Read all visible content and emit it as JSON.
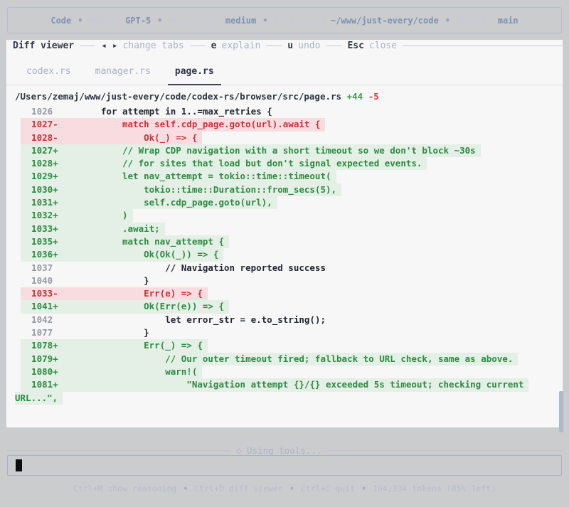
{
  "top_bar": {
    "app_name": "Code",
    "separator": "•",
    "items": [
      {
        "label": "Model: ",
        "value": "GPT-5"
      },
      {
        "label": "Reasoning: ",
        "value": "medium"
      },
      {
        "label": "Directory: ",
        "value": "~/www/just-every/code"
      },
      {
        "label": "Branch: ",
        "value": "main"
      }
    ]
  },
  "diff_viewer": {
    "title": "Diff viewer",
    "hints": [
      {
        "key": "◂ ▸",
        "label": "change tabs"
      },
      {
        "key": "e",
        "label": "explain"
      },
      {
        "key": "u",
        "label": "undo"
      },
      {
        "key": "Esc",
        "label": "close"
      }
    ],
    "tabs": [
      {
        "id": "codex-rs",
        "label": "codex.rs",
        "active": false
      },
      {
        "id": "manager-rs",
        "label": "manager.rs",
        "active": false
      },
      {
        "id": "page-rs",
        "label": "page.rs",
        "active": true
      }
    ],
    "file_header": {
      "path": "/Users/zemaj/www/just-every/code/codex-rs/browser/src/page.rs",
      "additions": "+44",
      "deletions": "-5"
    },
    "lines": [
      {
        "num": "1026",
        "sign": " ",
        "type": "ctx",
        "code": "        for attempt in 1..=max_retries {"
      },
      {
        "num": "1027",
        "sign": "-",
        "type": "del",
        "code": "            match self.cdp_page.goto(url).await {"
      },
      {
        "num": "1028",
        "sign": "-",
        "type": "del",
        "code": "                Ok(_) => {"
      },
      {
        "num": "1027",
        "sign": "+",
        "type": "add",
        "code": "            // Wrap CDP navigation with a short timeout so we don't block ~30s"
      },
      {
        "num": "1028",
        "sign": "+",
        "type": "add",
        "code": "            // for sites that load but don't signal expected events."
      },
      {
        "num": "1029",
        "sign": "+",
        "type": "add",
        "code": "            let nav_attempt = tokio::time::timeout("
      },
      {
        "num": "1030",
        "sign": "+",
        "type": "add",
        "code": "                tokio::time::Duration::from_secs(5),"
      },
      {
        "num": "1031",
        "sign": "+",
        "type": "add",
        "code": "                self.cdp_page.goto(url),"
      },
      {
        "num": "1032",
        "sign": "+",
        "type": "add",
        "code": "            )"
      },
      {
        "num": "1033",
        "sign": "+",
        "type": "add",
        "code": "            .await;"
      },
      {
        "num": "1035",
        "sign": "+",
        "type": "add",
        "code": "            match nav_attempt {"
      },
      {
        "num": "1036",
        "sign": "+",
        "type": "add",
        "code": "                Ok(Ok(_)) => {"
      },
      {
        "num": "1037",
        "sign": " ",
        "type": "ctx",
        "code": "                    // Navigation reported success"
      },
      {
        "num": "1040",
        "sign": " ",
        "type": "ctx",
        "code": "                }"
      },
      {
        "num": "1033",
        "sign": "-",
        "type": "del",
        "code": "                Err(e) => {"
      },
      {
        "num": "1041",
        "sign": "+",
        "type": "add",
        "code": "                Ok(Err(e)) => {"
      },
      {
        "num": "1042",
        "sign": " ",
        "type": "ctx",
        "code": "                    let error_str = e.to_string();"
      },
      {
        "num": "1077",
        "sign": " ",
        "type": "ctx",
        "code": "                }"
      },
      {
        "num": "1078",
        "sign": "+",
        "type": "add",
        "code": "                Err(_) => {"
      },
      {
        "num": "1079",
        "sign": "+",
        "type": "add",
        "code": "                    // Our outer timeout fired; fallback to URL check, same as above."
      },
      {
        "num": "1080",
        "sign": "+",
        "type": "add",
        "code": "                    warn!("
      },
      {
        "num": "1081",
        "sign": "+",
        "type": "add",
        "code": "                        \"Navigation attempt {}/{} exceeded 5s timeout; checking current"
      },
      {
        "cont": true,
        "type": "add",
        "code": "URL...\","
      }
    ]
  },
  "status_divider": {
    "icon": "◇",
    "label": "Using tools..."
  },
  "composer": {
    "value": "",
    "cursor": "block"
  },
  "footer": {
    "hints": [
      {
        "key": "Ctrl+R",
        "label": "show reasoning"
      },
      {
        "key": "Ctrl+D",
        "label": "diff viewer"
      },
      {
        "key": "Ctrl+C",
        "label": "quit"
      }
    ],
    "tokens": "104,334 tokens (85% left)"
  },
  "colors": {
    "page_bg": "#cbccce",
    "panel_bg": "#f7f7f8",
    "accent_blue": "#7e91b4",
    "muted_blue": "#a9b3c7",
    "del_text": "#c23438",
    "del_bg": "#f9dce0",
    "add_text": "#2e8b44",
    "add_bg": "#e4efe5",
    "ctx_text": "#22262f",
    "line_number": "#959aa3"
  }
}
